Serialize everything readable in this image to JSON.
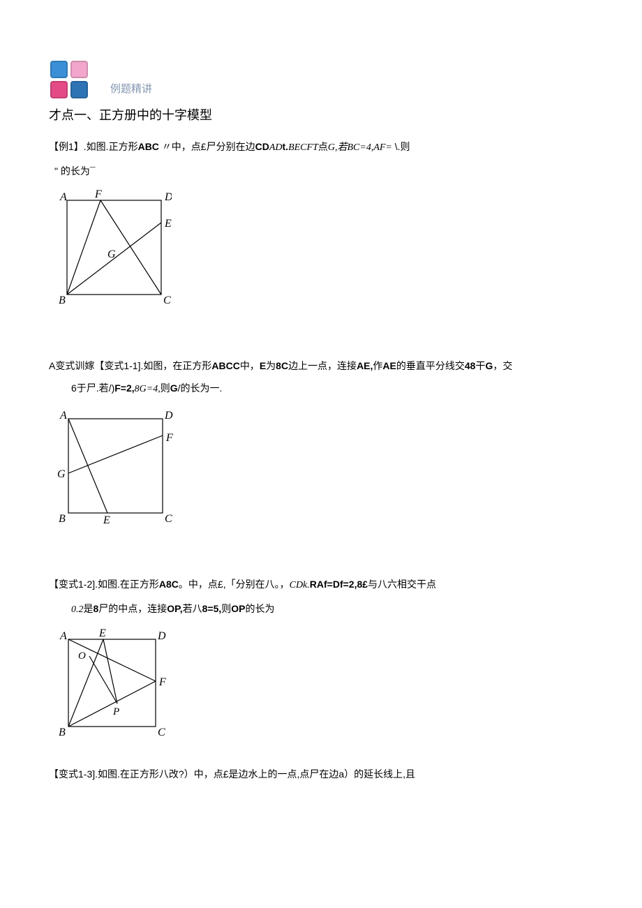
{
  "header": {
    "subtitle": "例题精讲"
  },
  "topic": "才点一、正方册中的十字模型",
  "problems": {
    "p1": {
      "line1_a": "【例1】.如图.正方形",
      "line1_b": "ABC",
      "line1_c": "〃中，点£尸分别在边",
      "line1_d": "CD",
      "line1_e": "AD",
      "line1_f": "t.",
      "line1_g": "BECFT",
      "line1_h": "点",
      "line1_i": "G,",
      "line1_j": "若",
      "line1_k": "BC=4,AF=",
      "line1_l": "\\.则",
      "line2": "\" 的长为¯"
    },
    "p2": {
      "line1_a": "A变式训嫁【变式1-1].如图，在正方形",
      "line1_b": "ABCC",
      "line1_c": "中，",
      "line1_d": "E",
      "line1_e": "为",
      "line1_f": "8C",
      "line1_g": "边上一点，连接",
      "line1_h": "AE,",
      "line1_i": "作",
      "line1_j": "AE",
      "line1_k": "的垂直平分线交",
      "line1_l": "48",
      "line1_m": "干",
      "line1_n": "G",
      "line1_o": "，交",
      "line2_a": "6于尸.若/)",
      "line2_b": "F=2,",
      "line2_c": "8G=4,",
      "line2_d": "则",
      "line2_e": "G",
      "line2_f": "/的长为一."
    },
    "p3": {
      "line1_a": "【变式1-2].如图.在正方形",
      "line1_b": "A8C",
      "line1_c": "。中，点£,「分别在八。，",
      "line1_d": "CDk.",
      "line1_e": "RAf=Df=2,8£",
      "line1_f": "与八六相交干点",
      "line2_a": "0.2",
      "line2_b": "是",
      "line2_c": "8",
      "line2_d": "尸的中点，连接",
      "line2_e": "OP,",
      "line2_f": "若八",
      "line2_g": "8=5,",
      "line2_h": "则",
      "line2_i": "OP",
      "line2_j": "的长为"
    },
    "p4": {
      "line1": "【变式1-3].如图.在正方形八改?）中，点£是边水上的一点,点尸在边a）的延长线上,且"
    }
  },
  "labels": {
    "A": "A",
    "B": "B",
    "C": "C",
    "D": "D",
    "E": "E",
    "F": "F",
    "G": "G",
    "O": "O",
    "P": "P"
  }
}
